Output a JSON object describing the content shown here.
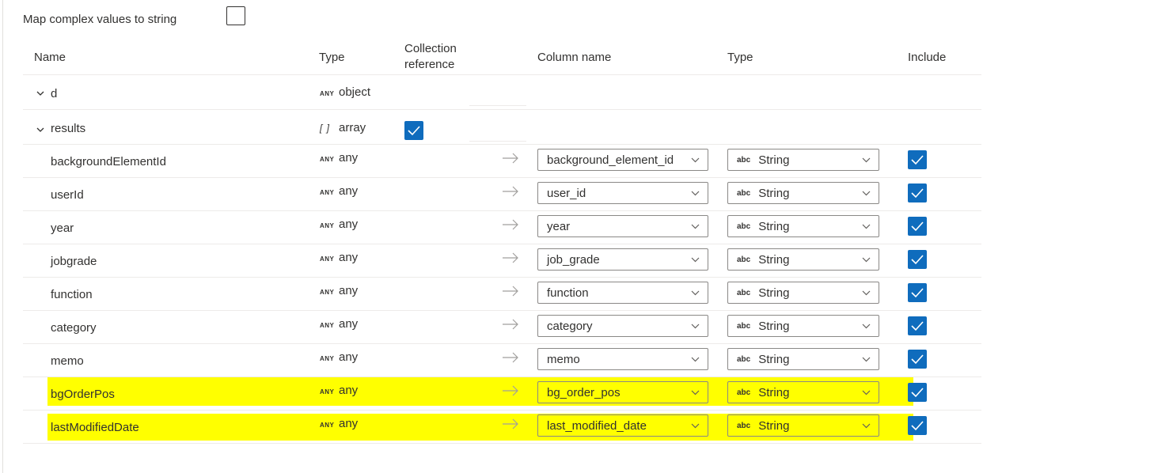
{
  "option": {
    "label": "Map complex values to string",
    "checked": false
  },
  "headers": {
    "name": "Name",
    "type": "Type",
    "collection_line1": "Collection",
    "collection_line2": "reference",
    "column_name": "Column name",
    "target_type": "Type",
    "include": "Include"
  },
  "tree": [
    {
      "name": "d",
      "type_badge": "ANY",
      "type": "object"
    },
    {
      "name": "results",
      "type_badge": "[ ]",
      "type": "array",
      "collection_reference": true
    }
  ],
  "mappings": [
    {
      "name": "backgroundElementId",
      "type_badge": "ANY",
      "type": "any",
      "column": "background_element_id",
      "target_badge": "abc",
      "target_type": "String",
      "include": true,
      "highlighted": false
    },
    {
      "name": "userId",
      "type_badge": "ANY",
      "type": "any",
      "column": "user_id",
      "target_badge": "abc",
      "target_type": "String",
      "include": true,
      "highlighted": false
    },
    {
      "name": "year",
      "type_badge": "ANY",
      "type": "any",
      "column": "year",
      "target_badge": "abc",
      "target_type": "String",
      "include": true,
      "highlighted": false
    },
    {
      "name": "jobgrade",
      "type_badge": "ANY",
      "type": "any",
      "column": "job_grade",
      "target_badge": "abc",
      "target_type": "String",
      "include": true,
      "highlighted": false
    },
    {
      "name": "function",
      "type_badge": "ANY",
      "type": "any",
      "column": "function",
      "target_badge": "abc",
      "target_type": "String",
      "include": true,
      "highlighted": false
    },
    {
      "name": "category",
      "type_badge": "ANY",
      "type": "any",
      "column": "category",
      "target_badge": "abc",
      "target_type": "String",
      "include": true,
      "highlighted": false
    },
    {
      "name": "memo",
      "type_badge": "ANY",
      "type": "any",
      "column": "memo",
      "target_badge": "abc",
      "target_type": "String",
      "include": true,
      "highlighted": false
    },
    {
      "name": "bgOrderPos",
      "type_badge": "ANY",
      "type": "any",
      "column": "bg_order_pos",
      "target_badge": "abc",
      "target_type": "String",
      "include": true,
      "highlighted": true
    },
    {
      "name": "lastModifiedDate",
      "type_badge": "ANY",
      "type": "any",
      "column": "last_modified_date",
      "target_badge": "abc",
      "target_type": "String",
      "include": true,
      "highlighted": true
    }
  ],
  "colors": {
    "accent": "#0f6cbd",
    "highlight": "#ffff00",
    "border": "#8a8886",
    "divider": "#edebe9"
  },
  "icons": {
    "expand": "chevron-down-icon",
    "map": "arrow-right-icon",
    "dropdown": "chevron-down-icon",
    "check": "checkmark-icon"
  }
}
